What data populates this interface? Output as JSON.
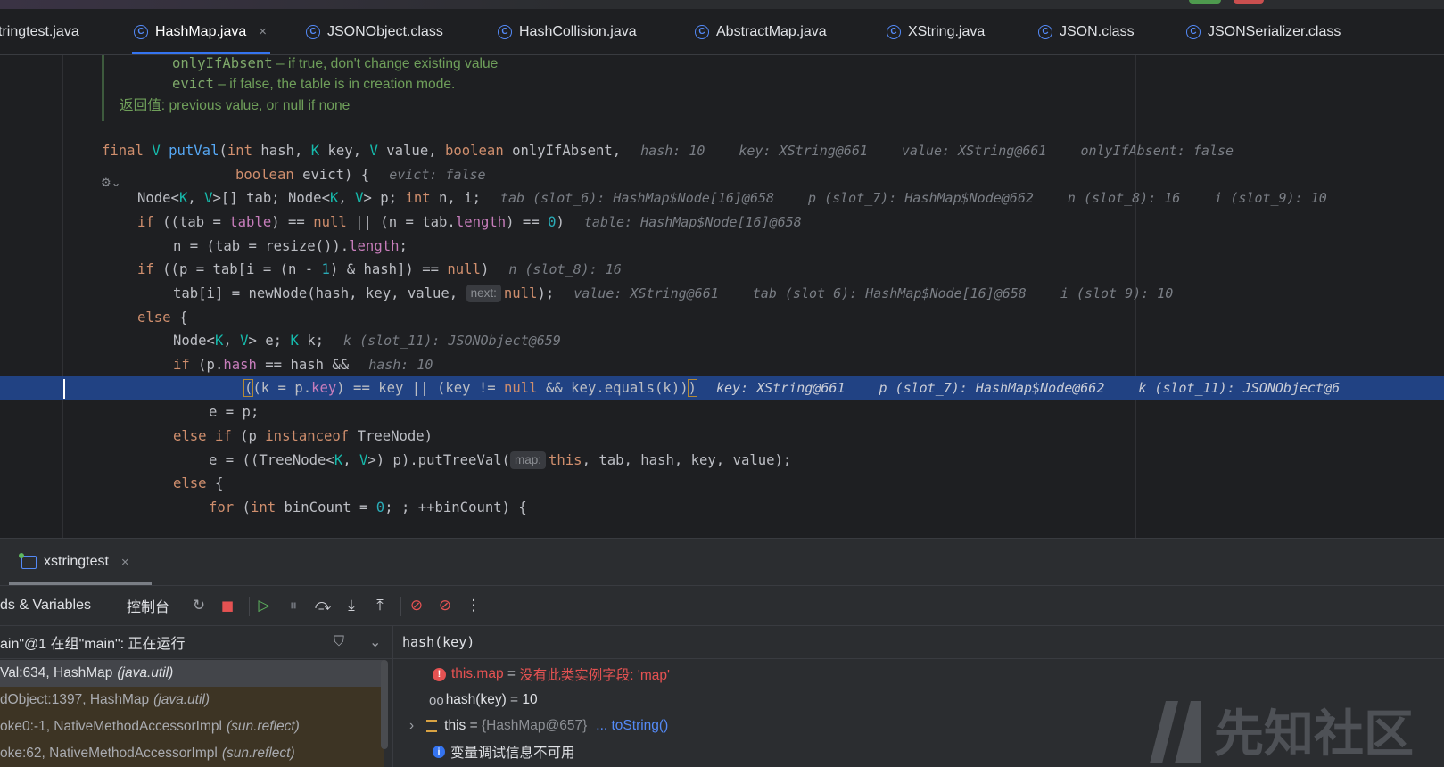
{
  "tabs": [
    {
      "label": "tringtest.java",
      "has_icon": false
    },
    {
      "label": "HashMap.java",
      "active": true
    },
    {
      "label": "JSONObject.class"
    },
    {
      "label": "HashCollision.java"
    },
    {
      "label": "AbstractMap.java"
    },
    {
      "label": "XString.java"
    },
    {
      "label": "JSON.class"
    },
    {
      "label": "JSONSerializer.class"
    }
  ],
  "tab_icon_letter": "C",
  "tab_close": "×",
  "doc": {
    "line1_param": "onlyIfAbsent",
    "line1_text": " – if true, don't change existing value",
    "line2_param": "evict",
    "line2_text": " – if false, the table is in creation mode.",
    "line3": "返回值: previous value, or null if none"
  },
  "gear_glyph": "⚙⌄",
  "code": {
    "l1": {
      "kw_final": "final ",
      "V": "V",
      "fn": "putVal",
      "p1": "(",
      "kw_int": "int",
      "p2": " hash, ",
      "K": "K",
      "p3": " key, ",
      "V2": "V",
      "p4": " value, ",
      "kw_bool": "boolean",
      "p5": " onlyIfAbsent,",
      "h1": "hash: 10",
      "h2": "key: XString@661",
      "h3": "value: XString@661",
      "h4": "onlyIfAbsent: false"
    },
    "l2": {
      "kw_bool": "boolean",
      "p1": " evict) {",
      "h1": "evict: false"
    },
    "l3": {
      "p1": "Node<",
      "K": "K",
      "c": ", ",
      "V": "V",
      "p2": ">[] tab; Node<",
      "K2": "K",
      "c2": ", ",
      "V2": "V",
      "p3": "> p; ",
      "kw_int": "int",
      "p4": " n, i;",
      "h1": "tab (slot_6): HashMap$Node[16]@658",
      "h2": "p (slot_7): HashMap$Node@662",
      "h3": "n (slot_8): 16",
      "h4": "i (slot_9): 10"
    },
    "l4": {
      "kw_if": "if",
      "p1": " ((tab = ",
      "fld": "table",
      "p2": ") == ",
      "kw_null": "null",
      "p3": " || (n = tab.",
      "fld2": "length",
      "p4": ") == ",
      "num": "0",
      "p5": ")",
      "h1": "table: HashMap$Node[16]@658"
    },
    "l5": {
      "p1": "n = (tab = resize()).",
      "fld": "length",
      "p2": ";"
    },
    "l6": {
      "kw_if": "if",
      "p1": " ((p = tab[i = (n - ",
      "num": "1",
      "p2": ") & hash]) == ",
      "kw_null": "null",
      "p3": ")",
      "h1": "n (slot_8): 16"
    },
    "l7": {
      "p1": "tab[i] = newNode(hash, key, value, ",
      "inlay": "next:",
      "kw_null": "null",
      "p2": ");",
      "h1": "value: XString@661",
      "h2": "tab (slot_6): HashMap$Node[16]@658",
      "h3": "i (slot_9): 10"
    },
    "l8": {
      "kw_else": "else",
      "p1": " {"
    },
    "l9": {
      "p1": "Node<",
      "K": "K",
      "c": ", ",
      "V": "V",
      "p2": "> e; ",
      "K2": "K",
      "p3": " k;",
      "h1": "k (slot_11): JSONObject@659"
    },
    "l10": {
      "kw_if": "if",
      "p1": " (p.",
      "fld": "hash",
      "p2": " == hash &&",
      "h1": "hash: 10"
    },
    "l11": {
      "b1": "(",
      "p1": "(k = p.",
      "fld": "key",
      "p2": ") == key || (key != ",
      "kw_null": "null",
      "p3": " && key.equals(k))",
      "b2": ")",
      "h1": "key: XString@661",
      "h2": "p (slot_7): HashMap$Node@662",
      "h3": "k (slot_11): JSONObject@6"
    },
    "l12": {
      "p1": "e = p;"
    },
    "l13": {
      "kw_else": "else",
      "p1": " ",
      "kw_if": "if",
      "p2": " (p ",
      "kw_inst": "instanceof",
      "p3": " TreeNode)"
    },
    "l14": {
      "p1": "e = ((TreeNode<",
      "K": "K",
      "c": ", ",
      "V": "V",
      "p2": ">) p).putTreeVal(",
      "inlay": "map:",
      "kw_this": "this",
      "p3": ", tab, hash, key, value);"
    },
    "l15": {
      "kw_else": "else",
      "p1": " {"
    },
    "l16": {
      "kw_for": "for",
      "p1": " (",
      "kw_int": "int",
      "p2": " binCount = ",
      "num": "0",
      "p3": "; ; ++binCount) {"
    }
  },
  "run_tab": {
    "label": "xstringtest",
    "close": "×"
  },
  "toolbar": {
    "tab_threads": "ds & Variables",
    "tab_console": "控制台",
    "btn_rerun": "↻",
    "btn_stop": "■",
    "btn_resume": "▷",
    "btn_pause": "⏸",
    "btn_step_over": "⤼",
    "btn_step_into": "⤓",
    "btn_step_out": "⤒",
    "btn_breakpoints": "⊘",
    "btn_mute": "⊘",
    "btn_more": "⋮"
  },
  "thread_status": "ain\"@1 在组\"main\": 正在运行",
  "filter_icon": "⛉",
  "chevron": "⌄",
  "frames": [
    {
      "method": "Val:634, HashMap",
      "pkg": "(java.util)"
    },
    {
      "method": "dObject:1397, HashMap",
      "pkg": "(java.util)"
    },
    {
      "method": "oke0:-1, NativeMethodAccessorImpl",
      "pkg": "(sun.reflect)"
    },
    {
      "method": "oke:62, NativeMethodAccessorImpl",
      "pkg": "(sun.reflect)"
    }
  ],
  "eval_expression": "hash(key)",
  "variables": {
    "err_name": "this.map",
    "err_eq": " = ",
    "err_value": "没有此类实例字段: 'map'",
    "watch_name": "hash(key)",
    "watch_eq": " = ",
    "watch_value": "10",
    "this_name": "this",
    "this_eq": " = ",
    "this_value": "{HashMap@657}",
    "this_link": "... toString()",
    "info_text": "变量调试信息不可用"
  },
  "watermark_text": "先知社区",
  "colors": {
    "selection": "#214283",
    "accent": "#3574f0",
    "error": "#e55252"
  }
}
